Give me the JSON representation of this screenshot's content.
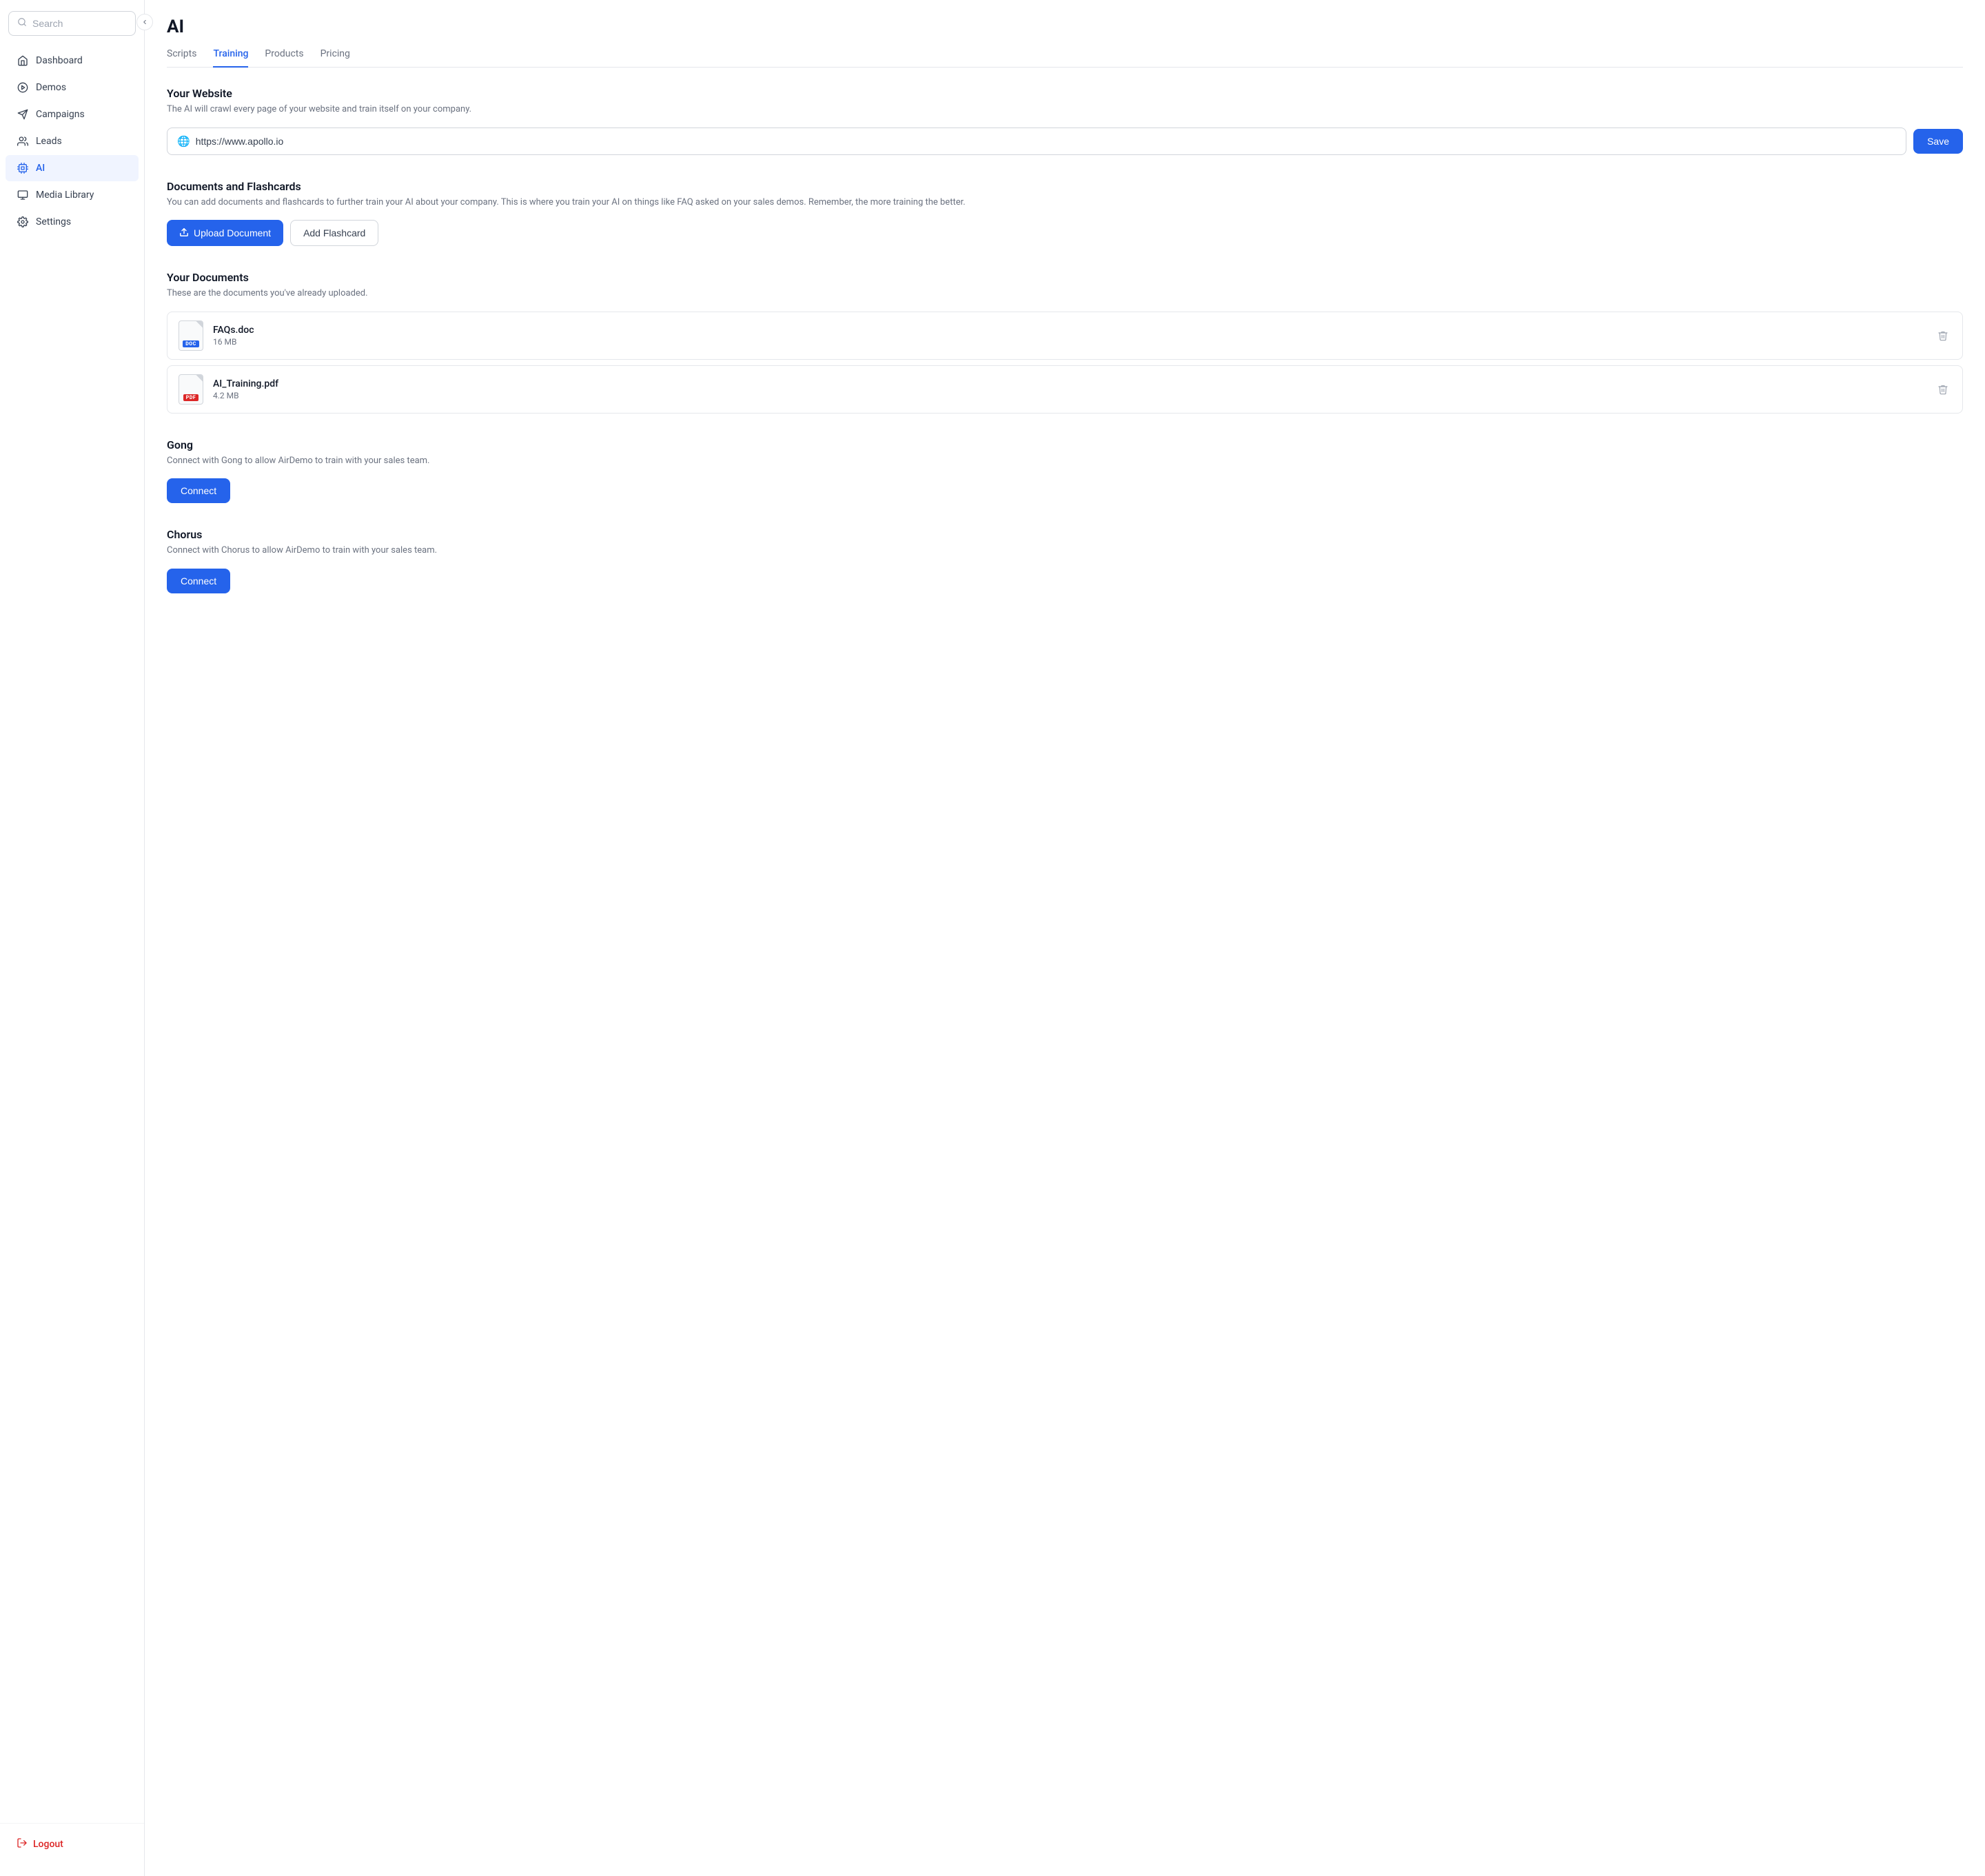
{
  "sidebar": {
    "search_placeholder": "Search",
    "nav_items": [
      {
        "id": "dashboard",
        "label": "Dashboard",
        "icon": "home",
        "active": false
      },
      {
        "id": "demos",
        "label": "Demos",
        "icon": "play-circle",
        "active": false
      },
      {
        "id": "campaigns",
        "label": "Campaigns",
        "icon": "send",
        "active": false
      },
      {
        "id": "leads",
        "label": "Leads",
        "icon": "users",
        "active": false
      },
      {
        "id": "ai",
        "label": "AI",
        "icon": "cpu",
        "active": true
      },
      {
        "id": "media-library",
        "label": "Media Library",
        "icon": "monitor",
        "active": false
      },
      {
        "id": "settings",
        "label": "Settings",
        "icon": "settings",
        "active": false
      }
    ],
    "logout_label": "Logout"
  },
  "page": {
    "title": "AI",
    "tabs": [
      {
        "id": "scripts",
        "label": "Scripts",
        "active": false
      },
      {
        "id": "training",
        "label": "Training",
        "active": true
      },
      {
        "id": "products",
        "label": "Products",
        "active": false
      },
      {
        "id": "pricing",
        "label": "Pricing",
        "active": false
      }
    ]
  },
  "training": {
    "website_section": {
      "title": "Your Website",
      "description": "The AI will crawl every page of your website and train itself on your company.",
      "url_value": "https://www.apollo.io",
      "save_label": "Save"
    },
    "documents_section": {
      "title": "Documents and Flashcards",
      "description": "You can add documents and flashcards to further train your AI about your company. This is where you train your AI on things like FAQ asked on your sales demos. Remember, the more training the better.",
      "upload_label": "Upload Document",
      "flashcard_label": "Add Flashcard"
    },
    "your_documents_section": {
      "title": "Your Documents",
      "description": "These are the documents you've already uploaded.",
      "documents": [
        {
          "id": "doc1",
          "name": "FAQs.doc",
          "size": "16 MB",
          "type": "doc",
          "badge": "DOC"
        },
        {
          "id": "doc2",
          "name": "AI_Training.pdf",
          "size": "4.2 MB",
          "type": "pdf",
          "badge": "PDF"
        }
      ]
    },
    "gong_section": {
      "title": "Gong",
      "description": "Connect with Gong to allow AirDemo to train with your sales team.",
      "connect_label": "Connect"
    },
    "chorus_section": {
      "title": "Chorus",
      "description": "Connect with Chorus to allow AirDemo to train with your sales team.",
      "connect_label": "Connect"
    }
  },
  "colors": {
    "primary": "#2563eb",
    "danger": "#dc2626"
  }
}
